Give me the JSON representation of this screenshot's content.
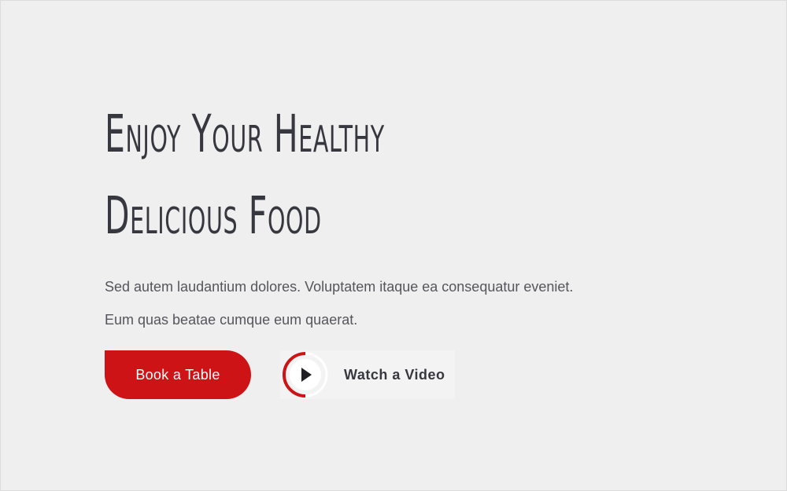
{
  "hero": {
    "title_line1": "Enjoy Your Healthy",
    "title_line2": "Delicious Food",
    "description": "Sed autem laudantium dolores. Voluptatem itaque ea consequatur eveniet. Eum quas beatae cumque eum quaerat."
  },
  "actions": {
    "book_label": "Book a Table",
    "video_label": "Watch a Video",
    "video_icon": "play-icon"
  },
  "colors": {
    "accent": "#cd1315",
    "heading": "#37373f",
    "text": "#55555c",
    "background": "#efefef"
  }
}
